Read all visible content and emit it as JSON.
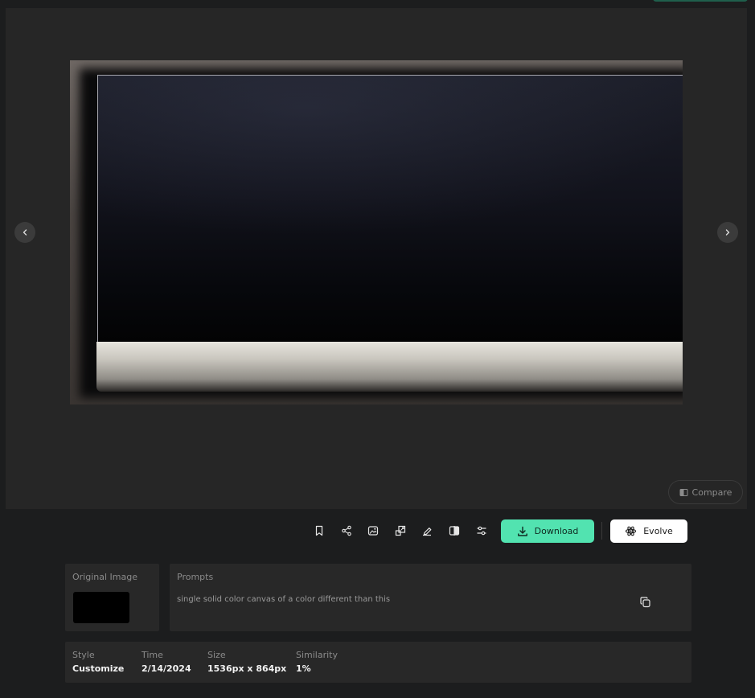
{
  "viewer": {
    "compare_label": "Compare",
    "prev_icon": "chevron-left-icon",
    "next_icon": "chevron-right-icon"
  },
  "toolbar": {
    "icons": [
      "bookmark-icon",
      "share-icon",
      "image-icon",
      "upscale-icon",
      "erase-icon",
      "compare-split-icon",
      "sliders-icon"
    ],
    "download_label": "Download",
    "evolve_label": "Evolve",
    "download_color": "#52e3b0"
  },
  "original": {
    "label": "Original Image"
  },
  "prompts": {
    "label": "Prompts",
    "text": "single solid color canvas of a color different than this"
  },
  "meta": {
    "style": {
      "label": "Style",
      "value": "Customize"
    },
    "time": {
      "label": "Time",
      "value": "2/14/2024"
    },
    "size": {
      "label": "Size",
      "value": "1536px x 864px"
    },
    "similarity": {
      "label": "Similarity",
      "value": "1%"
    }
  }
}
